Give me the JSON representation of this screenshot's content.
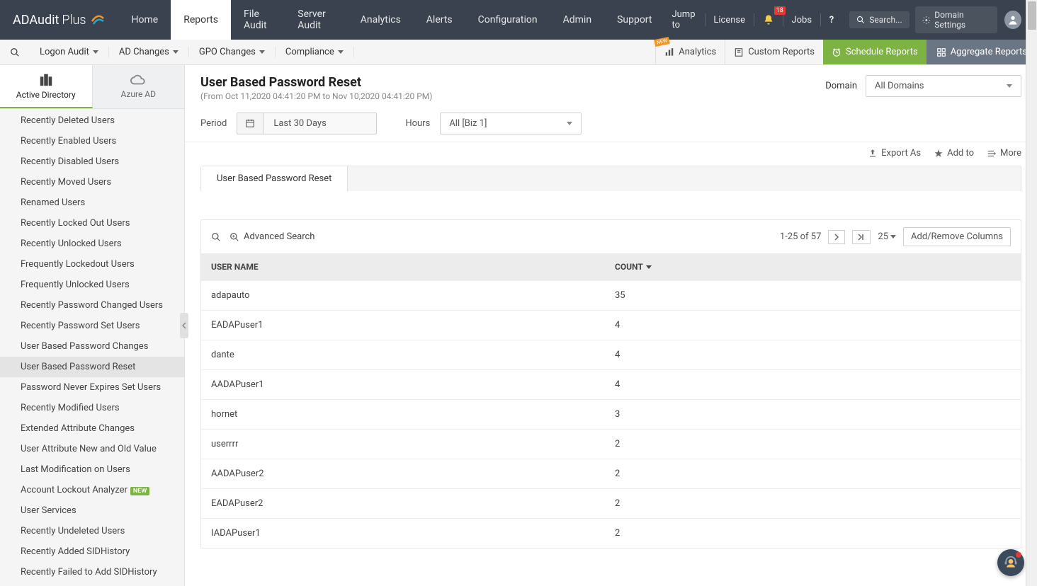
{
  "brand": {
    "name": "ADAudit",
    "suffix": "Plus"
  },
  "header": {
    "nav": [
      "Home",
      "Reports",
      "File Audit",
      "Server Audit",
      "Analytics",
      "Alerts",
      "Configuration",
      "Admin",
      "Support"
    ],
    "active_nav": "Reports",
    "jump_to": "Jump to",
    "license": "License",
    "bell_count": "18",
    "jobs": "Jobs",
    "search_placeholder": "Search...",
    "domain_settings": "Domain Settings"
  },
  "subnav": {
    "items": [
      "Logon Audit",
      "AD Changes",
      "GPO Changes",
      "Compliance"
    ],
    "analytics": "Analytics",
    "custom_reports": "Custom Reports",
    "schedule_reports": "Schedule Reports",
    "aggregate_reports": "Aggregate Reports",
    "new_tag": "NEW"
  },
  "dir_tabs": {
    "ad": "Active Directory",
    "azure": "Azure AD"
  },
  "sidebar": {
    "items": [
      "Recently Deleted Users",
      "Recently Enabled Users",
      "Recently Disabled Users",
      "Recently Moved Users",
      "Renamed Users",
      "Recently Locked Out Users",
      "Recently Unlocked Users",
      "Frequently Lockedout Users",
      "Frequently Unlocked Users",
      "Recently Password Changed Users",
      "Recently Password Set Users",
      "User Based Password Changes",
      "User Based Password Reset",
      "Password Never Expires Set Users",
      "Recently Modified Users",
      "Extended Attribute Changes",
      "User Attribute New and Old Value",
      "Last Modification on Users",
      "Account Lockout Analyzer",
      "User Services",
      "Recently Undeleted Users",
      "Recently Added SIDHistory",
      "Recently Failed to Add SIDHistory"
    ],
    "active": "User Based Password Reset",
    "new_items": [
      "Account Lockout Analyzer"
    ],
    "new_badge": "NEW"
  },
  "page": {
    "title": "User Based Password Reset",
    "subtitle": "(From Oct 11,2020 04:41:20 PM to Nov 10,2020 04:41:20 PM)",
    "domain_label": "Domain",
    "domain_value": "All Domains",
    "period_label": "Period",
    "period_value": "Last 30 Days",
    "hours_label": "Hours",
    "hours_value": "All [Biz 1]",
    "export_as": "Export As",
    "add_to": "Add to",
    "more": "More",
    "tab": "User Based Password Reset",
    "adv_search": "Advanced Search",
    "page_info": "1-25 of 57",
    "page_size": "25",
    "add_cols": "Add/Remove Columns",
    "col_user": "USER NAME",
    "col_count": "COUNT"
  },
  "rows": [
    {
      "name": "adapauto",
      "count": "35"
    },
    {
      "name": "EADAPuser1",
      "count": "4"
    },
    {
      "name": "dante",
      "count": "4"
    },
    {
      "name": "AADAPuser1",
      "count": "4"
    },
    {
      "name": "hornet",
      "count": "3"
    },
    {
      "name": "userrrr",
      "count": "2"
    },
    {
      "name": "AADAPuser2",
      "count": "2"
    },
    {
      "name": "EADAPuser2",
      "count": "2"
    },
    {
      "name": "IADAPuser1",
      "count": "2"
    }
  ]
}
